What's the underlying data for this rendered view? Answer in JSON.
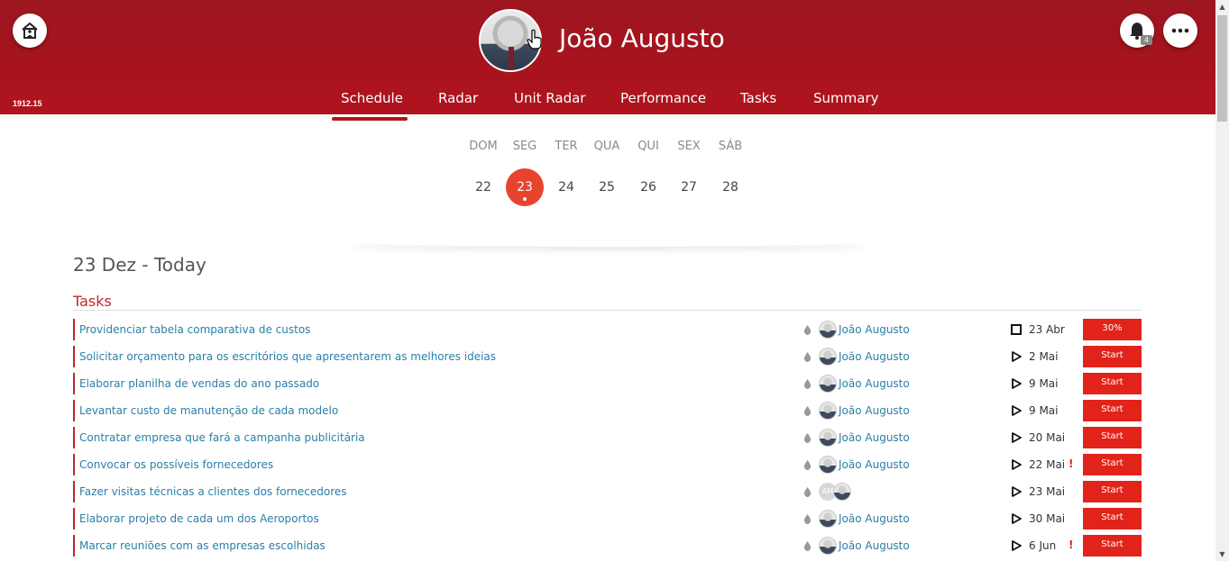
{
  "header": {
    "user_name": "João Augusto",
    "version": "1912.15",
    "notification_count": "4",
    "brand_color": "#a8131d"
  },
  "nav": {
    "tabs": [
      {
        "label": "Schedule",
        "active": true
      },
      {
        "label": "Radar"
      },
      {
        "label": "Unit Radar"
      },
      {
        "label": "Performance"
      },
      {
        "label": "Tasks"
      },
      {
        "label": "Summary"
      }
    ]
  },
  "calendar": {
    "weekdays": [
      "DOM",
      "SEG",
      "TER",
      "QUA",
      "QUI",
      "SEX",
      "SÁB"
    ],
    "days": [
      "22",
      "23",
      "24",
      "25",
      "26",
      "27",
      "28"
    ],
    "selected": "23",
    "accent": "#e8432f"
  },
  "main": {
    "date_title": "23 Dez - Today",
    "section_title": "Tasks"
  },
  "tasks": [
    {
      "title": "Providenciar tabela comparativa de custos",
      "owner": "João Augusto",
      "status": "square",
      "due": "23 Abr",
      "warn": "",
      "action": "30%"
    },
    {
      "title": "Solicitar orçamento para os escritórios que apresentarem as melhores ideias",
      "owner": "João Augusto",
      "status": "play",
      "due": "2 Mai",
      "warn": "",
      "action": "Start"
    },
    {
      "title": "Elaborar planilha de vendas do ano passado",
      "owner": "João Augusto",
      "status": "play",
      "due": "9 Mai",
      "warn": "",
      "action": "Start"
    },
    {
      "title": "Levantar custo de manutenção de cada modelo",
      "owner": "João Augusto",
      "status": "play",
      "due": "9 Mai",
      "warn": "",
      "action": "Start"
    },
    {
      "title": "Contratar empresa que fará a campanha publicitária",
      "owner": "João Augusto",
      "status": "play",
      "due": "20 Mai",
      "warn": "",
      "action": "Start"
    },
    {
      "title": "Convocar os possíveis fornecedores",
      "owner": "João Augusto",
      "status": "play",
      "due": "22 Mai",
      "warn": "!",
      "action": "Start"
    },
    {
      "title": "Fazer visitas técnicas a clientes dos fornecedores",
      "owner": "",
      "initials": "AM",
      "status": "play",
      "due": "23 Mai",
      "warn": "",
      "action": "Start"
    },
    {
      "title": "Elaborar projeto de cada um dos Aeroportos",
      "owner": "João Augusto",
      "status": "play",
      "due": "30 Mai",
      "warn": "",
      "action": "Start"
    },
    {
      "title": "Marcar reuniões com as empresas escolhidas",
      "owner": "João Augusto",
      "status": "play",
      "due": "6 Jun",
      "warn": "!",
      "action": "Start"
    }
  ]
}
